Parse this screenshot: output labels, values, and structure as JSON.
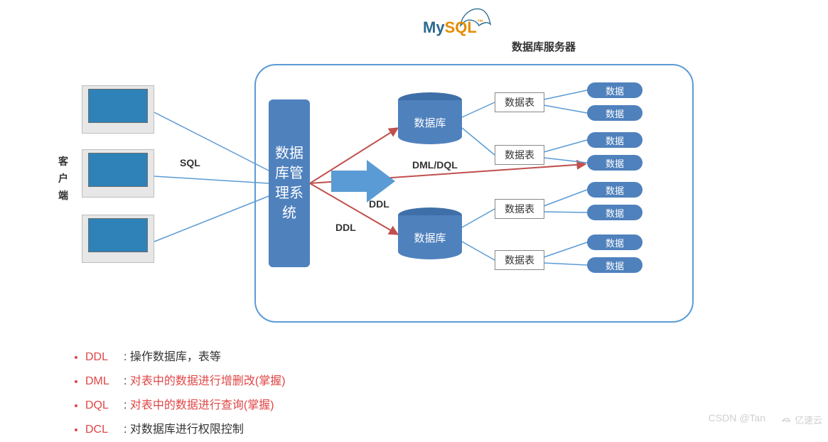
{
  "logo": {
    "part1": "My",
    "part2": "SQL",
    "tm": "™"
  },
  "server_title": "数据库服务器",
  "client_label": "客户端",
  "dbms_label": "数据库管理系统",
  "arrow_label_client": "SQL",
  "labels": {
    "dml_dql": "DML/DQL",
    "ddl1": "DDL",
    "ddl2": "DDL"
  },
  "database_label": "数据库",
  "table_label": "数据表",
  "data_label": "数据",
  "legend": [
    {
      "abbr": "DDL",
      "desc": "操作数据库，表等",
      "highlight": false
    },
    {
      "abbr": "DML",
      "desc": "对表中的数据进行增删改(掌握)",
      "highlight": true
    },
    {
      "abbr": "DQL",
      "desc": "对表中的数据进行查询(掌握)",
      "highlight": true
    },
    {
      "abbr": "DCL",
      "desc": "对数据库进行权限控制",
      "highlight": false
    }
  ],
  "watermark1": "CSDN @Tan",
  "watermark2": "亿速云"
}
